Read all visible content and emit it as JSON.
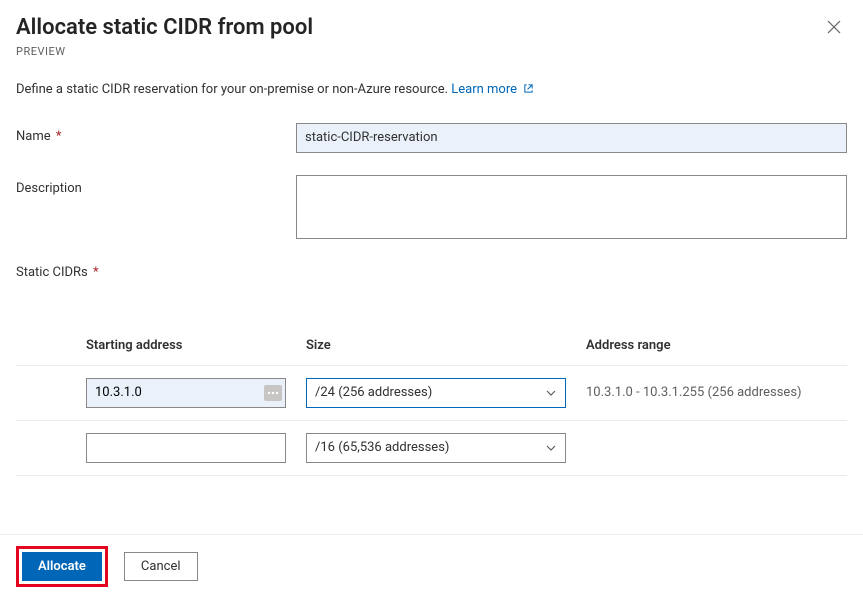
{
  "header": {
    "title": "Allocate static CIDR from pool",
    "preview": "PREVIEW"
  },
  "description": {
    "text": "Define a static CIDR reservation for your on-premise or non-Azure resource. ",
    "learn_more": "Learn more"
  },
  "form": {
    "name_label": "Name",
    "name_value": "static-CIDR-reservation",
    "desc_label": "Description",
    "desc_value": "",
    "static_label": "Static CIDRs"
  },
  "table": {
    "headers": {
      "starting": "Starting address",
      "size": "Size",
      "range": "Address range"
    },
    "rows": [
      {
        "starting": "10.3.1.0",
        "size": "/24 (256 addresses)",
        "range": "10.3.1.0 - 10.3.1.255 (256 addresses)",
        "active": true
      },
      {
        "starting": "",
        "size": "/16 (65,536 addresses)",
        "range": "",
        "active": false
      }
    ]
  },
  "footer": {
    "allocate": "Allocate",
    "cancel": "Cancel"
  }
}
